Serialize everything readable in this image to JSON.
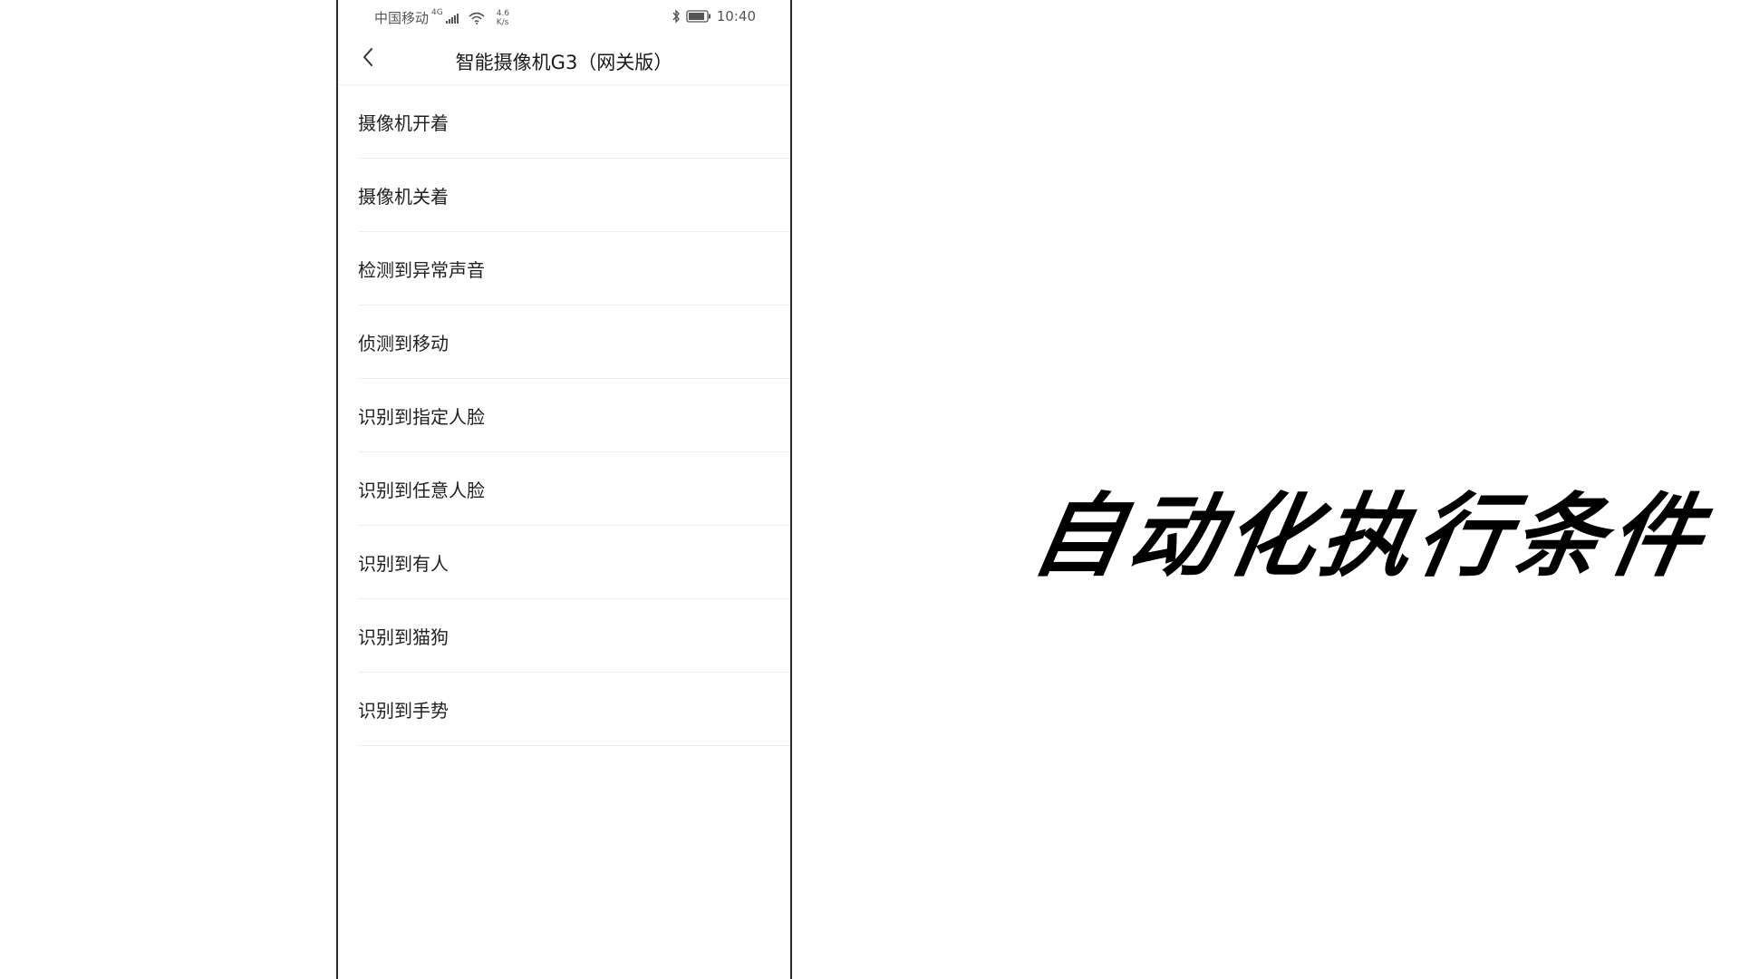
{
  "status_bar": {
    "carrier": "中国移动",
    "network_type": "4G",
    "speed_value": "4.6",
    "speed_unit": "K/s",
    "time": "10:40",
    "icons": [
      "signal-icon",
      "wifi-icon",
      "bluetooth-icon",
      "battery-icon"
    ]
  },
  "header": {
    "back_icon": "chevron-left-icon",
    "title": "智能摄像机G3（网关版）"
  },
  "conditions": [
    {
      "label": "摄像机开着"
    },
    {
      "label": "摄像机关着"
    },
    {
      "label": "检测到异常声音"
    },
    {
      "label": "侦测到移动"
    },
    {
      "label": "识别到指定人脸"
    },
    {
      "label": "识别到任意人脸"
    },
    {
      "label": "识别到有人"
    },
    {
      "label": "识别到猫狗"
    },
    {
      "label": "识别到手势"
    }
  ],
  "headline": "自动化执行条件",
  "colors": {
    "background": "#ffffff",
    "text_primary": "#222222",
    "divider": "#eeeeee",
    "headline": "#000000"
  }
}
